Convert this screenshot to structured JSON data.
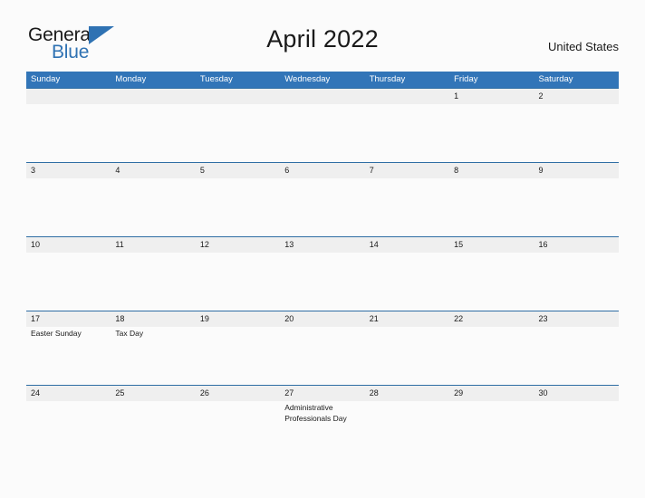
{
  "logo": {
    "word_one": "General",
    "word_two": "Blue",
    "triangle_icon": "triangle-icon",
    "accent_color": "#2f72b3"
  },
  "header": {
    "title": "April 2022",
    "region": "United States"
  },
  "colors": {
    "header_blue": "#3275b8",
    "separator_blue": "#2e6da4",
    "number_band": "#efefef",
    "page_background": "#fbfbfb"
  },
  "calendar": {
    "day_headers": [
      "Sunday",
      "Monday",
      "Tuesday",
      "Wednesday",
      "Thursday",
      "Friday",
      "Saturday"
    ],
    "weeks": [
      {
        "numbers": [
          "",
          "",
          "",
          "",
          "",
          "1",
          "2"
        ],
        "events": [
          "",
          "",
          "",
          "",
          "",
          "",
          ""
        ]
      },
      {
        "numbers": [
          "3",
          "4",
          "5",
          "6",
          "7",
          "8",
          "9"
        ],
        "events": [
          "",
          "",
          "",
          "",
          "",
          "",
          ""
        ]
      },
      {
        "numbers": [
          "10",
          "11",
          "12",
          "13",
          "14",
          "15",
          "16"
        ],
        "events": [
          "",
          "",
          "",
          "",
          "",
          "",
          ""
        ]
      },
      {
        "numbers": [
          "17",
          "18",
          "19",
          "20",
          "21",
          "22",
          "23"
        ],
        "events": [
          "Easter Sunday",
          "Tax Day",
          "",
          "",
          "",
          "",
          ""
        ]
      },
      {
        "numbers": [
          "24",
          "25",
          "26",
          "27",
          "28",
          "29",
          "30"
        ],
        "events": [
          "",
          "",
          "",
          "Administrative Professionals Day",
          "",
          "",
          ""
        ]
      }
    ]
  }
}
